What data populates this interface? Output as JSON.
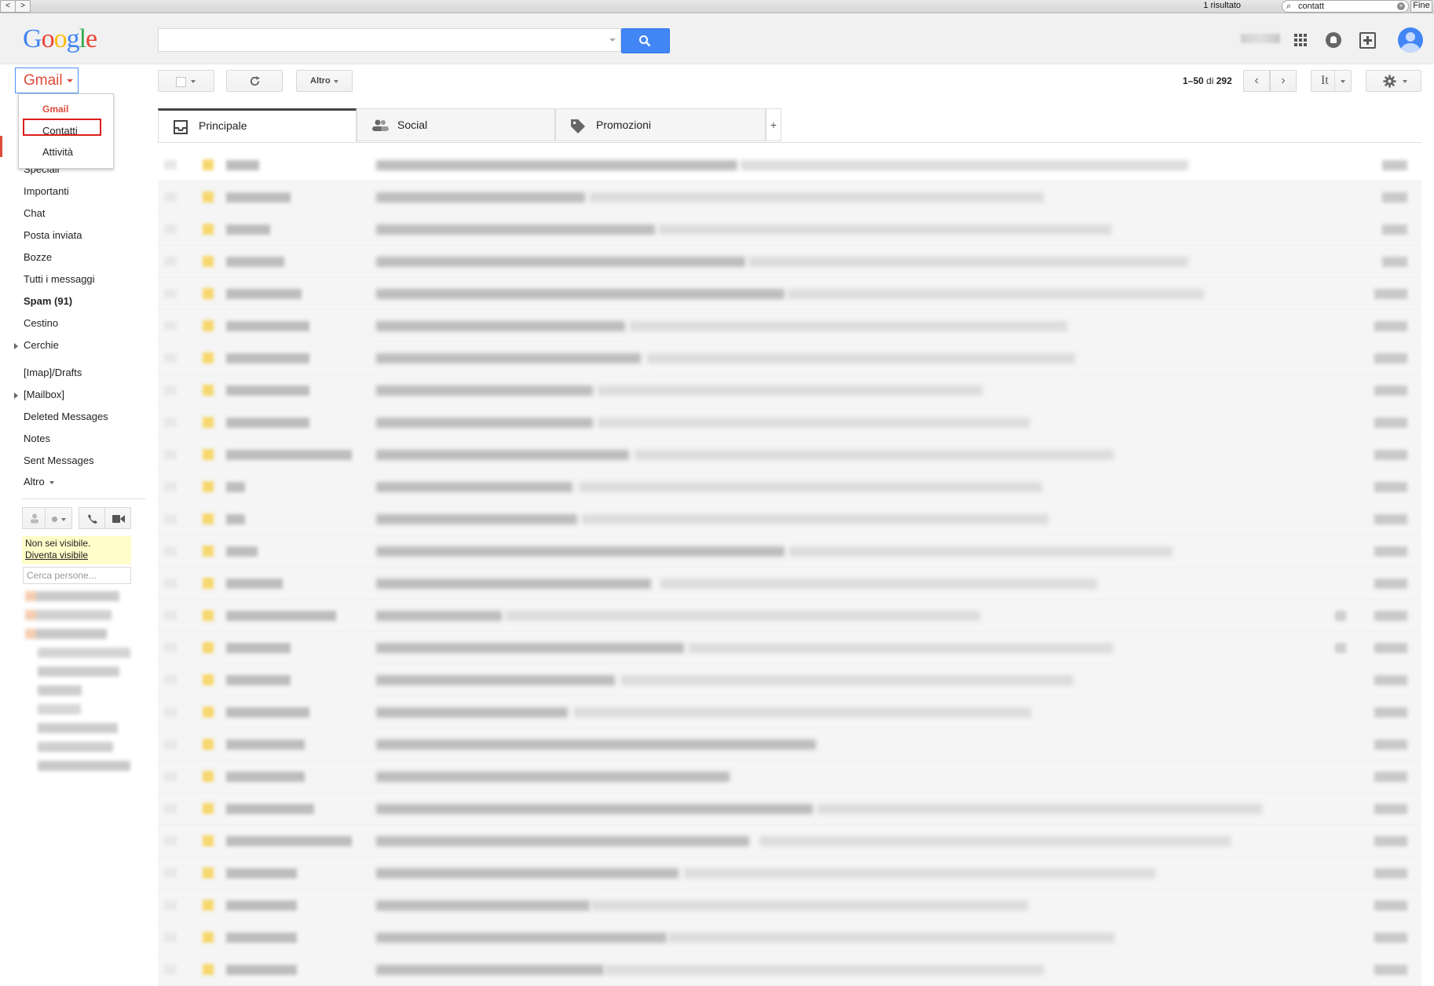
{
  "findbar": {
    "result": "1 risultato",
    "prev": "<",
    "next": ">",
    "query": "contatt",
    "done": "Fine"
  },
  "header": {
    "logo": [
      "G",
      "o",
      "o",
      "g",
      "l",
      "e"
    ]
  },
  "toolbar": {
    "gmail_label": "Gmail",
    "more_label": "Altro",
    "count_prefix": "1–50",
    "count_of": " di ",
    "count_total": "292",
    "lang_label": "It"
  },
  "gmail_menu": {
    "items": [
      "Gmail",
      "Contatti",
      "Attività"
    ],
    "highlighted": "Contatti"
  },
  "sidebar": {
    "items": [
      {
        "label": "Speciali"
      },
      {
        "label": "Importanti"
      },
      {
        "label": "Chat"
      },
      {
        "label": "Posta inviata"
      },
      {
        "label": "Bozze"
      },
      {
        "label": "Tutti i messaggi"
      },
      {
        "label": "Spam (91)"
      },
      {
        "label": "Cestino"
      },
      {
        "label": "Cerchie"
      },
      {
        "label": "[Imap]/Drafts"
      },
      {
        "label": "[Mailbox]"
      },
      {
        "label": "Deleted Messages"
      },
      {
        "label": "Notes"
      },
      {
        "label": "Sent Messages"
      },
      {
        "label": "Altro"
      }
    ]
  },
  "chat": {
    "invisible_text": "Non sei visibile.",
    "become_visible": "Diventa visibile",
    "search_placeholder": "Cerca persone..."
  },
  "tabs": [
    {
      "label": "Principale",
      "icon": "inbox-icon",
      "active": true
    },
    {
      "label": "Social",
      "icon": "people-icon",
      "active": false
    },
    {
      "label": "Promozioni",
      "icon": "tag-icon",
      "active": false
    }
  ],
  "colors": {
    "accent_red": "#dd4b39",
    "search_blue": "#4285f4",
    "highlight_border": "#dd1e1e"
  }
}
